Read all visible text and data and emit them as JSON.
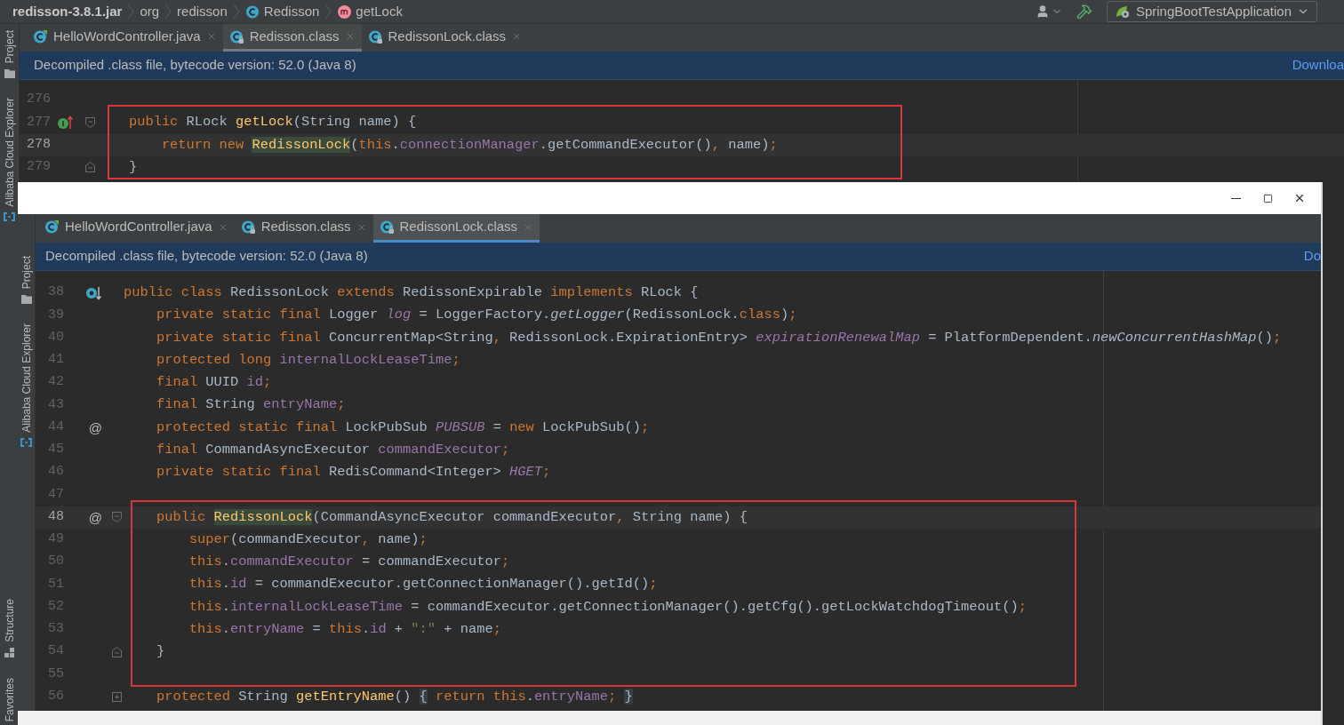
{
  "breadcrumb": [
    {
      "label": "redisson-3.8.1.jar",
      "kind": "jar"
    },
    {
      "label": "org",
      "kind": "package"
    },
    {
      "label": "redisson",
      "kind": "package"
    },
    {
      "label": "Redisson",
      "kind": "class"
    },
    {
      "label": "getLock",
      "kind": "method"
    }
  ],
  "run_config": {
    "label": "SpringBootTestApplication"
  },
  "tool_strip": {
    "top": [
      {
        "label": "Project",
        "kind": "folder"
      },
      {
        "label": "Alibaba Cloud Explorer",
        "kind": "cloud"
      }
    ],
    "bottom": [
      {
        "label": "Structure",
        "kind": "structure"
      },
      {
        "label": "Favorites",
        "kind": "none"
      }
    ]
  },
  "editor": {
    "focused": false,
    "tabs": [
      {
        "label": "HelloWordController.java",
        "kind": "java",
        "selected": false
      },
      {
        "label": "Redisson.class",
        "kind": "class",
        "selected": true
      },
      {
        "label": "RedissonLock.class",
        "kind": "class",
        "selected": false
      }
    ],
    "banner": {
      "text": "Decompiled .class file, bytecode version: 52.0 (Java 8)",
      "link": "Downloa"
    },
    "blocks": [
      {
        "framed": false,
        "lines": [
          {
            "number": "276",
            "current": false
          }
        ]
      },
      {
        "framed": true,
        "lines": [
          {
            "number": "277",
            "current": false,
            "marker": {
              "kind": "implementing"
            },
            "fold": {
              "kind": "start"
            },
            "tokens": [
              {
                "text": "    public ",
                "kind": "kw"
              },
              {
                "text": "RLock ",
                "kind": "plain"
              },
              {
                "text": "getLock",
                "kind": "method"
              },
              {
                "text": "(String name) {",
                "kind": "plain"
              }
            ]
          },
          {
            "number": "278",
            "current": true,
            "tokens": [
              {
                "text": "        return new ",
                "kind": "kw"
              },
              {
                "text": "RedissonLock",
                "kind": "usage"
              },
              {
                "text": "(",
                "kind": "plain"
              },
              {
                "text": "this",
                "kind": "kw"
              },
              {
                "text": ".",
                "kind": "plain"
              },
              {
                "text": "connectionManager",
                "kind": "field"
              },
              {
                "text": ".getCommandExecutor()",
                "kind": "plain"
              },
              {
                "text": ", ",
                "kind": "kw"
              },
              {
                "text": "name)",
                "kind": "plain"
              },
              {
                "text": ";",
                "kind": "kw"
              }
            ]
          },
          {
            "number": "279",
            "current": false,
            "fold": {
              "kind": "end"
            },
            "tokens": [
              {
                "text": "    }",
                "kind": "plain"
              }
            ]
          }
        ]
      }
    ]
  },
  "window": {
    "focused": true,
    "tool_strip": [
      {
        "label": "Project",
        "kind": "folder"
      },
      {
        "label": "Alibaba Cloud Explorer",
        "kind": "cloud"
      }
    ],
    "tabs": [
      {
        "label": "HelloWordController.java",
        "kind": "java",
        "selected": false
      },
      {
        "label": "Redisson.class",
        "kind": "class",
        "selected": false
      },
      {
        "label": "RedissonLock.class",
        "kind": "class",
        "selected": true
      }
    ],
    "banner": {
      "text": "Decompiled .class file, bytecode version: 52.0 (Java 8)",
      "link": "Do"
    },
    "blocks": [
      {
        "framed": false,
        "lines": [
          {
            "number": "38",
            "current": false,
            "marker": {
              "kind": "implemented"
            },
            "tokens": [
              {
                "text": "public class ",
                "kind": "kw"
              },
              {
                "text": "RedissonLock ",
                "kind": "plain"
              },
              {
                "text": "extends ",
                "kind": "kw"
              },
              {
                "text": "RedissonExpirable ",
                "kind": "plain"
              },
              {
                "text": "implements ",
                "kind": "kw"
              },
              {
                "text": "RLock {",
                "kind": "plain"
              }
            ]
          },
          {
            "number": "39",
            "current": false,
            "tokens": [
              {
                "text": "    private static final ",
                "kind": "kw"
              },
              {
                "text": "Logger ",
                "kind": "plain"
              },
              {
                "text": "log",
                "kind": "sfield"
              },
              {
                "text": " = LoggerFactory.",
                "kind": "plain"
              },
              {
                "text": "getLogger",
                "kind": "scall"
              },
              {
                "text": "(RedissonLock.",
                "kind": "plain"
              },
              {
                "text": "class",
                "kind": "kw"
              },
              {
                "text": ")",
                "kind": "plain"
              },
              {
                "text": ";",
                "kind": "kw"
              }
            ]
          },
          {
            "number": "40",
            "current": false,
            "tokens": [
              {
                "text": "    private static final ",
                "kind": "kw"
              },
              {
                "text": "ConcurrentMap<String",
                "kind": "plain"
              },
              {
                "text": ", ",
                "kind": "kw"
              },
              {
                "text": "RedissonLock.ExpirationEntry> ",
                "kind": "plain"
              },
              {
                "text": "expirationRenewalMap",
                "kind": "sfield"
              },
              {
                "text": " = PlatformDependent.",
                "kind": "plain"
              },
              {
                "text": "newConcurrentHashMap",
                "kind": "scall"
              },
              {
                "text": "()",
                "kind": "plain"
              },
              {
                "text": ";",
                "kind": "kw"
              }
            ]
          },
          {
            "number": "41",
            "current": false,
            "tokens": [
              {
                "text": "    protected long ",
                "kind": "kw"
              },
              {
                "text": "internalLockLeaseTime",
                "kind": "field"
              },
              {
                "text": ";",
                "kind": "kw"
              }
            ]
          },
          {
            "number": "42",
            "current": false,
            "tokens": [
              {
                "text": "    final ",
                "kind": "kw"
              },
              {
                "text": "UUID ",
                "kind": "plain"
              },
              {
                "text": "id",
                "kind": "field"
              },
              {
                "text": ";",
                "kind": "kw"
              }
            ]
          },
          {
            "number": "43",
            "current": false,
            "tokens": [
              {
                "text": "    final ",
                "kind": "kw"
              },
              {
                "text": "String ",
                "kind": "plain"
              },
              {
                "text": "entryName",
                "kind": "field"
              },
              {
                "text": ";",
                "kind": "kw"
              }
            ]
          },
          {
            "number": "44",
            "current": false,
            "gutter_mark": "@",
            "tokens": [
              {
                "text": "    protected static final ",
                "kind": "kw"
              },
              {
                "text": "LockPubSub ",
                "kind": "plain"
              },
              {
                "text": "PUBSUB",
                "kind": "sfield"
              },
              {
                "text": " = ",
                "kind": "plain"
              },
              {
                "text": "new ",
                "kind": "kw"
              },
              {
                "text": "LockPubSub()",
                "kind": "plain"
              },
              {
                "text": ";",
                "kind": "kw"
              }
            ]
          },
          {
            "number": "45",
            "current": false,
            "tokens": [
              {
                "text": "    final ",
                "kind": "kw"
              },
              {
                "text": "CommandAsyncExecutor ",
                "kind": "plain"
              },
              {
                "text": "commandExecutor",
                "kind": "field"
              },
              {
                "text": ";",
                "kind": "kw"
              }
            ]
          },
          {
            "number": "46",
            "current": false,
            "tokens": [
              {
                "text": "    private static final ",
                "kind": "kw"
              },
              {
                "text": "RedisCommand<Integer> ",
                "kind": "plain"
              },
              {
                "text": "HGET",
                "kind": "sfield"
              },
              {
                "text": ";",
                "kind": "kw"
              }
            ]
          },
          {
            "number": "47",
            "current": false
          }
        ]
      },
      {
        "framed": true,
        "lines": [
          {
            "number": "48",
            "current": true,
            "gutter_mark": "@",
            "fold": {
              "kind": "start"
            },
            "tokens": [
              {
                "text": "    public ",
                "kind": "kw"
              },
              {
                "text": "RedissonLock",
                "kind": "usage"
              },
              {
                "text": "(CommandAsyncExecutor commandExecutor",
                "kind": "plain"
              },
              {
                "text": ", ",
                "kind": "kw"
              },
              {
                "text": "String name) {",
                "kind": "plain"
              }
            ]
          },
          {
            "number": "49",
            "current": false,
            "tokens": [
              {
                "text": "        super",
                "kind": "kw"
              },
              {
                "text": "(commandExecutor",
                "kind": "plain"
              },
              {
                "text": ", ",
                "kind": "kw"
              },
              {
                "text": "name)",
                "kind": "plain"
              },
              {
                "text": ";",
                "kind": "kw"
              }
            ]
          },
          {
            "number": "50",
            "current": false,
            "tokens": [
              {
                "text": "        this",
                "kind": "kw"
              },
              {
                "text": ".",
                "kind": "plain"
              },
              {
                "text": "commandExecutor",
                "kind": "field"
              },
              {
                "text": " = commandExecutor",
                "kind": "plain"
              },
              {
                "text": ";",
                "kind": "kw"
              }
            ]
          },
          {
            "number": "51",
            "current": false,
            "tokens": [
              {
                "text": "        this",
                "kind": "kw"
              },
              {
                "text": ".",
                "kind": "plain"
              },
              {
                "text": "id",
                "kind": "field"
              },
              {
                "text": " = commandExecutor.getConnectionManager().getId()",
                "kind": "plain"
              },
              {
                "text": ";",
                "kind": "kw"
              }
            ]
          },
          {
            "number": "52",
            "current": false,
            "tokens": [
              {
                "text": "        this",
                "kind": "kw"
              },
              {
                "text": ".",
                "kind": "plain"
              },
              {
                "text": "internalLockLeaseTime",
                "kind": "field"
              },
              {
                "text": " = commandExecutor.getConnectionManager().getCfg().getLockWatchdogTimeout()",
                "kind": "plain"
              },
              {
                "text": ";",
                "kind": "kw"
              }
            ]
          },
          {
            "number": "53",
            "current": false,
            "tokens": [
              {
                "text": "        this",
                "kind": "kw"
              },
              {
                "text": ".",
                "kind": "plain"
              },
              {
                "text": "entryName",
                "kind": "field"
              },
              {
                "text": " = ",
                "kind": "plain"
              },
              {
                "text": "this",
                "kind": "kw"
              },
              {
                "text": ".",
                "kind": "plain"
              },
              {
                "text": "id",
                "kind": "field"
              },
              {
                "text": " + ",
                "kind": "plain"
              },
              {
                "text": "\":\"",
                "kind": "str"
              },
              {
                "text": " + name",
                "kind": "plain"
              },
              {
                "text": ";",
                "kind": "kw"
              }
            ]
          },
          {
            "number": "54",
            "current": false,
            "fold": {
              "kind": "end"
            },
            "tokens": [
              {
                "text": "    }",
                "kind": "plain"
              }
            ]
          },
          {
            "number": "55",
            "current": false
          }
        ]
      },
      {
        "framed": false,
        "lines": [
          {
            "number": "56",
            "current": false,
            "fold": {
              "kind": "collapsed"
            },
            "tokens": [
              {
                "text": "    protected ",
                "kind": "kw"
              },
              {
                "text": "String ",
                "kind": "plain"
              },
              {
                "text": "getEntryName",
                "kind": "method"
              },
              {
                "text": "() ",
                "kind": "plain"
              },
              {
                "text": "{",
                "kind": "folded"
              },
              {
                "text": " return ",
                "kind": "kw"
              },
              {
                "text": "this",
                "kind": "kw"
              },
              {
                "text": ".",
                "kind": "plain"
              },
              {
                "text": "entryName",
                "kind": "field"
              },
              {
                "text": "; ",
                "kind": "kw"
              },
              {
                "text": "}",
                "kind": "folded"
              }
            ]
          }
        ]
      }
    ]
  }
}
